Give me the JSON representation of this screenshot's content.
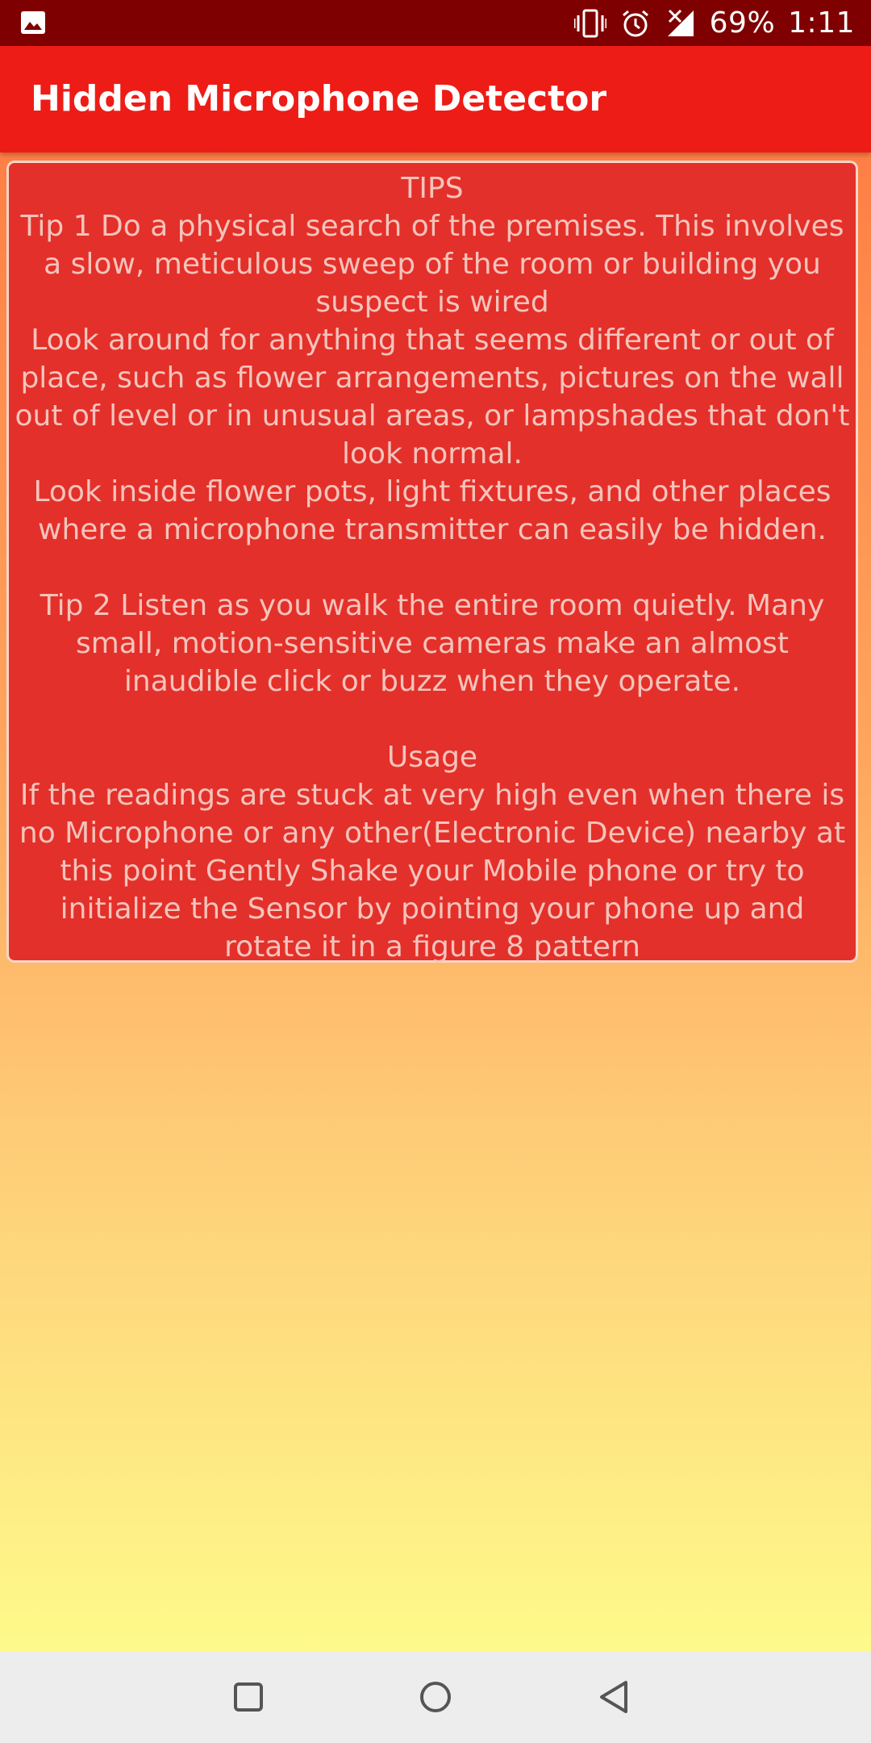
{
  "status_bar": {
    "left_icon": "image-icon",
    "icons": [
      "vibrate-icon",
      "alarm-icon",
      "signal-off-icon"
    ],
    "battery": "69%",
    "time": "1:11"
  },
  "app_bar": {
    "title": "Hidden Microphone Detector"
  },
  "tips": {
    "heading": "TIPS",
    "tip1_line1": "Tip 1 Do a physical search of the premises. This involves a slow, meticulous sweep of the room or building you suspect is wired",
    "tip1_line2": "Look around for anything that seems different or out of place, such as flower arrangements, pictures on the wall out of level or in unusual areas, or lampshades that don't look normal.",
    "tip1_line3": "Look inside flower pots, light fixtures, and other places where a microphone transmitter can easily be hidden.",
    "tip2": "Tip 2 Listen as you walk the entire room quietly. Many small, motion-sensitive cameras make an almost inaudible click or buzz when they operate.",
    "usage_heading": "Usage",
    "usage_text": "If the readings are stuck at very high even when there is no Microphone or any other(Electronic Device) nearby at this point Gently Shake your Mobile phone or try to initialize the Sensor by pointing your phone up and rotate it in a figure 8 pattern"
  },
  "nav_bar": {
    "icons": [
      "recents-square-icon",
      "home-circle-icon",
      "back-triangle-icon"
    ]
  },
  "colors": {
    "status_bar": "#7f0000",
    "app_bar": "#ee1c16",
    "card": "#e4302a",
    "card_text": "#f4c4bc",
    "gradient_top": "#fe7f45",
    "gradient_bottom": "#fefa8a"
  }
}
